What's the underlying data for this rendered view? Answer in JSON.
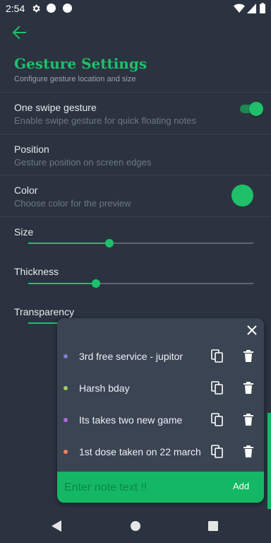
{
  "status_bar": {
    "time": "2:54"
  },
  "header": {
    "title": "Gesture Settings",
    "subtitle": "Configure gesture location and size"
  },
  "settings": {
    "one_swipe": {
      "title": "One swipe gesture",
      "subtitle": "Enable swipe gesture for quick floating notes",
      "enabled": true
    },
    "position": {
      "title": "Position",
      "subtitle": "Gesture position on screen edges"
    },
    "color": {
      "title": "Color",
      "subtitle": "Choose color for the preview",
      "value": "#1ec06a"
    },
    "size": {
      "title": "Size",
      "value": 0.36
    },
    "thickness": {
      "title": "Thickness",
      "value": 0.3
    },
    "transparency": {
      "title": "Transparency"
    }
  },
  "popup": {
    "notes": [
      {
        "text": "3rd free service - jupitor",
        "dot_color": "#7b7fd0"
      },
      {
        "text": "Harsh bday",
        "dot_color": "#9ccc65"
      },
      {
        "text": "Its takes two new game",
        "dot_color": "#ab6ad6"
      },
      {
        "text": "1st dose taken on 22 march",
        "dot_color": "#ef7e5c"
      }
    ],
    "input_placeholder": "Enter note text !!",
    "add_label": "Add"
  },
  "colors": {
    "accent": "#1ec06a",
    "background": "#2b3340",
    "popup": "#3a4452"
  }
}
